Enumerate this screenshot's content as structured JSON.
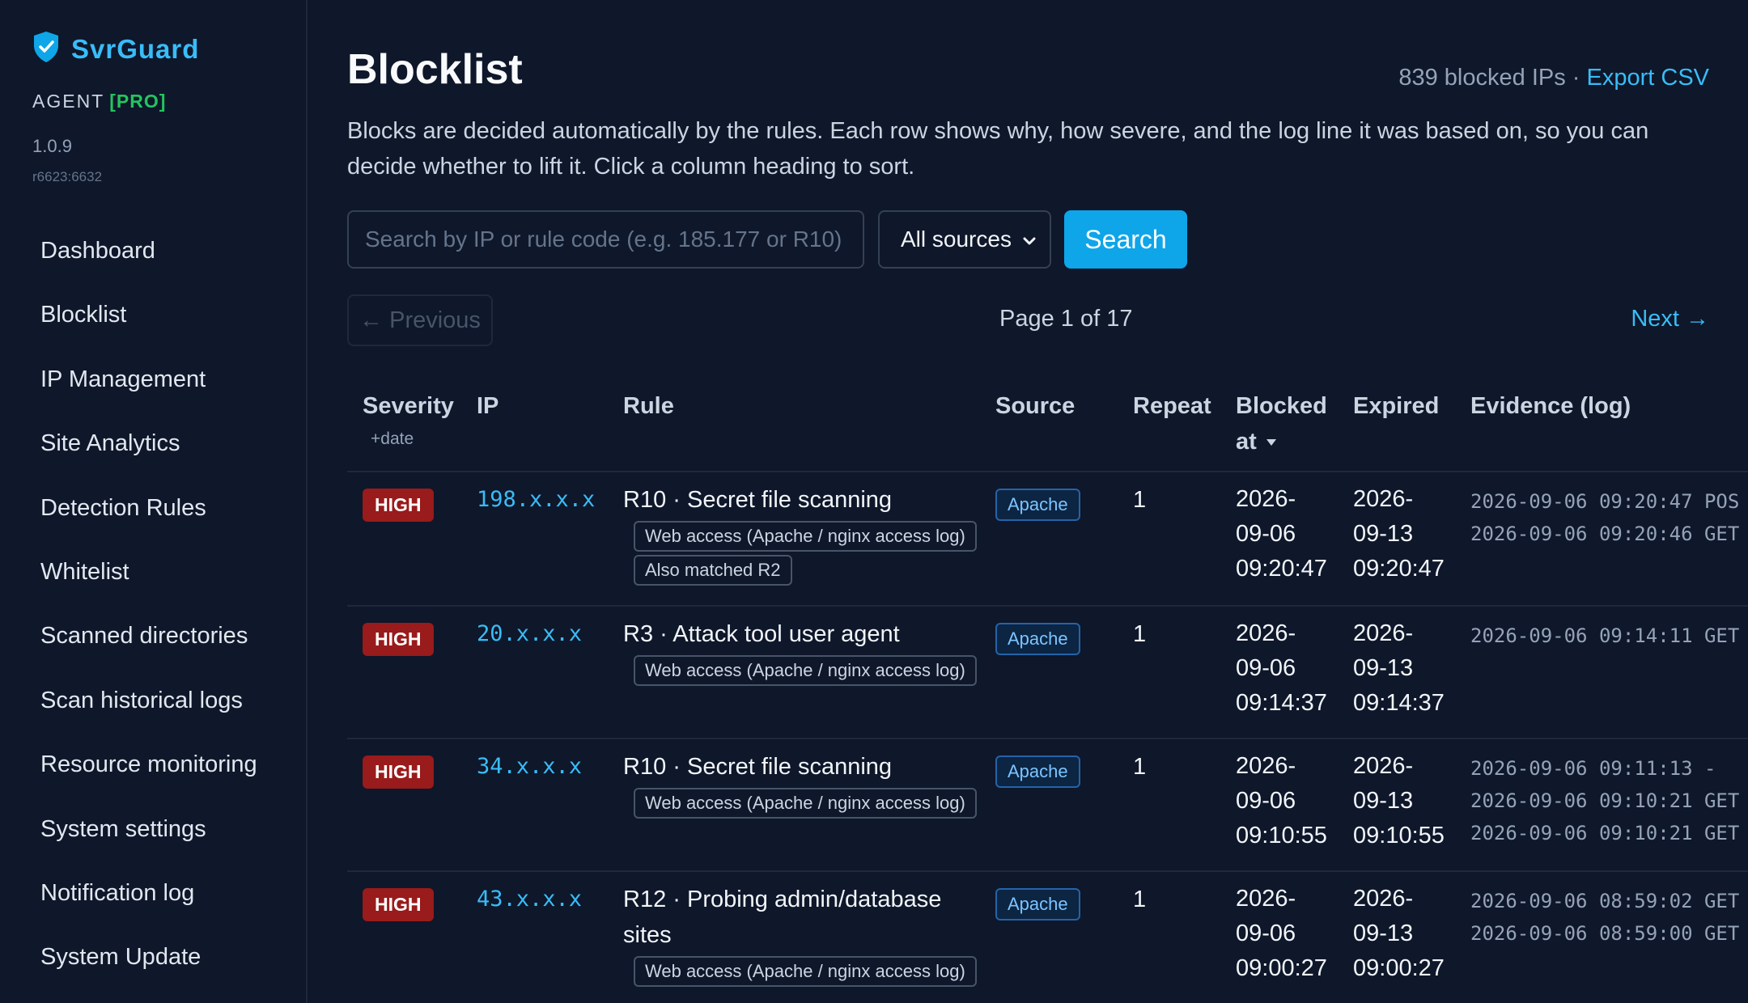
{
  "app": {
    "name": "SvrGuard",
    "agent_label": "AGENT",
    "tier": "[PRO]",
    "version": "1.0.9",
    "revision": "r6623:6632"
  },
  "nav": [
    {
      "label": "Dashboard"
    },
    {
      "label": "Blocklist"
    },
    {
      "label": "IP Management"
    },
    {
      "label": "Site Analytics"
    },
    {
      "label": "Detection Rules"
    },
    {
      "label": "Whitelist"
    },
    {
      "label": "Scanned directories"
    },
    {
      "label": "Scan historical logs"
    },
    {
      "label": "Resource monitoring"
    },
    {
      "label": "System settings"
    },
    {
      "label": "Notification log"
    },
    {
      "label": "System Update"
    }
  ],
  "page": {
    "title": "Blocklist",
    "count_text": "839 blocked IPs · ",
    "export_label": "Export CSV",
    "description": "Blocks are decided automatically by the rules. Each row shows why, how severe, and the log line it was based on, so you can decide whether to lift it. Click a column heading to sort."
  },
  "search": {
    "placeholder": "Search by IP or rule code (e.g. 185.177 or R10)",
    "value": "",
    "source_selected": "All sources",
    "button_label": "Search"
  },
  "pagination": {
    "prev_label": "← Previous",
    "page_text": "Page 1 of 17",
    "next_label": "Next →"
  },
  "table": {
    "headers": {
      "severity": "Severity",
      "severity_sub": "+date",
      "ip": "IP",
      "rule": "Rule",
      "source": "Source",
      "repeat": "Repeat",
      "blocked_at_1": "Blocked",
      "blocked_at_2": "at",
      "expired": "Expired",
      "evidence": "Evidence (log)"
    },
    "rows": [
      {
        "severity": "HIGH",
        "ip": "198.x.x.x",
        "rule": "R10 · Secret file scanning",
        "chips": [
          "Web access (Apache / nginx access log)",
          "Also matched R2"
        ],
        "source": "Apache",
        "repeat": "1",
        "blocked": [
          "2026-",
          "09-06",
          "09:20:47"
        ],
        "expired": [
          "2026-",
          "09-13",
          "09:20:47"
        ],
        "evidence": [
          "2026-09-06 09:20:47 POS",
          "2026-09-06 09:20:46 GET"
        ]
      },
      {
        "severity": "HIGH",
        "ip": "20.x.x.x",
        "rule": "R3 · Attack tool user agent",
        "chips": [
          "Web access (Apache / nginx access log)"
        ],
        "source": "Apache",
        "repeat": "1",
        "blocked": [
          "2026-",
          "09-06",
          "09:14:37"
        ],
        "expired": [
          "2026-",
          "09-13",
          "09:14:37"
        ],
        "evidence": [
          "2026-09-06 09:14:11 GET"
        ]
      },
      {
        "severity": "HIGH",
        "ip": "34.x.x.x",
        "rule": "R10 · Secret file scanning",
        "chips": [
          "Web access (Apache / nginx access log)"
        ],
        "source": "Apache",
        "repeat": "1",
        "blocked": [
          "2026-",
          "09-06",
          "09:10:55"
        ],
        "expired": [
          "2026-",
          "09-13",
          "09:10:55"
        ],
        "evidence": [
          "2026-09-06 09:11:13  -",
          "2026-09-06 09:10:21 GET",
          "2026-09-06 09:10:21 GET"
        ]
      },
      {
        "severity": "HIGH",
        "ip": "43.x.x.x",
        "rule": "R12 · Probing admin/database sites",
        "chips": [
          "Web access (Apache / nginx access log)"
        ],
        "source": "Apache",
        "repeat": "1",
        "blocked": [
          "2026-",
          "09-06",
          "09:00:27"
        ],
        "expired": [
          "2026-",
          "09-13",
          "09:00:27"
        ],
        "evidence": [
          "2026-09-06 08:59:02 GET",
          "2026-09-06 08:59:00 GET"
        ]
      }
    ]
  },
  "colors": {
    "background": "#0f172a",
    "accent": "#38bdf8",
    "pro": "#22c55e",
    "severity_high": "#991b1b",
    "primary_button": "#0ea5e9"
  }
}
